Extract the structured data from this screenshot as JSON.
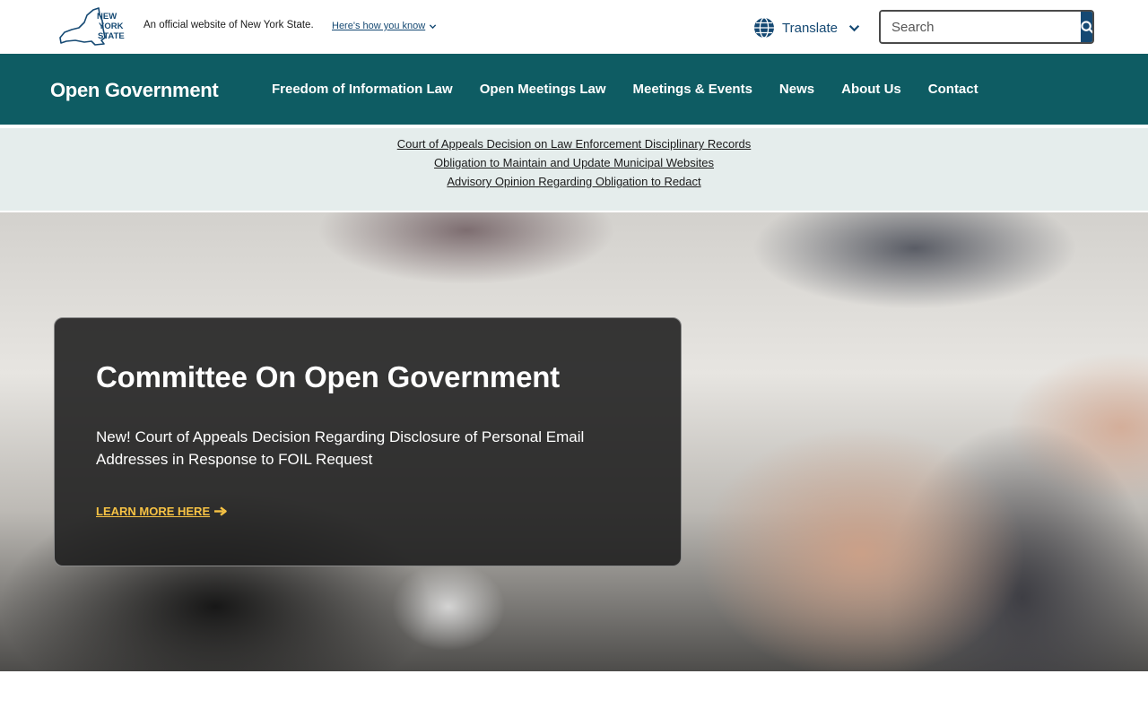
{
  "header": {
    "logo_text": "NEW YORK STATE",
    "official_text": "An official website of New York State.",
    "how_you_know": "Here's how you know",
    "translate_label": "Translate",
    "search_placeholder": "Search"
  },
  "nav": {
    "brand": "Open Government",
    "items": [
      {
        "label": "Freedom of Information Law"
      },
      {
        "label": "Open Meetings Law"
      },
      {
        "label": "Meetings & Events"
      },
      {
        "label": "News"
      },
      {
        "label": "About Us"
      },
      {
        "label": "Contact"
      }
    ]
  },
  "alerts": [
    "Court of Appeals Decision on Law Enforcement Disciplinary Records",
    "Obligation to Maintain and Update Municipal Websites",
    "Advisory Opinion Regarding Obligation to Redact"
  ],
  "hero": {
    "title": "Committee On Open Government",
    "body": "New! Court of Appeals Decision Regarding Disclosure of Personal Email Addresses in Response to FOIL Request",
    "cta": "LEARN MORE HERE"
  },
  "colors": {
    "nav_bg": "#0e5c63",
    "alert_bg": "#e5edec",
    "brand_blue": "#154973",
    "cta_gold": "#f6c244"
  }
}
